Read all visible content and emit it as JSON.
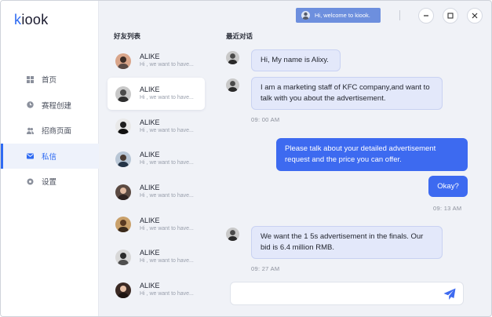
{
  "app": {
    "logo": "kiook",
    "logo_accent": "k",
    "logo_rest": "iook"
  },
  "header": {
    "welcome": "Hi, welcome to kiook."
  },
  "sidebar": {
    "items": [
      {
        "label": "首页",
        "icon": "dashboard-icon",
        "active": false
      },
      {
        "label": "赛程创建",
        "icon": "clock-icon",
        "active": false
      },
      {
        "label": "招商页面",
        "icon": "people-icon",
        "active": false
      },
      {
        "label": "私信",
        "icon": "mail-icon",
        "active": true
      },
      {
        "label": "设置",
        "icon": "gear-icon",
        "active": false
      }
    ]
  },
  "friends": {
    "title": "好友列表",
    "items": [
      {
        "name": "ALIKE",
        "preview": "Hi , we want to have..."
      },
      {
        "name": "ALIKE",
        "preview": "Hi , we want to have..."
      },
      {
        "name": "ALIKE",
        "preview": "Hi , we want to have..."
      },
      {
        "name": "ALIKE",
        "preview": "Hi , we want to have..."
      },
      {
        "name": "ALIKE",
        "preview": "Hi , we want to have..."
      },
      {
        "name": "ALIKE",
        "preview": "Hi , we want to have..."
      },
      {
        "name": "ALIKE",
        "preview": "Hi , we want to have..."
      },
      {
        "name": "ALIKE",
        "preview": "Hi , we want to have..."
      }
    ]
  },
  "chat": {
    "title": "最近对话",
    "messages": [
      {
        "text": "Hi, My name is Alixy."
      },
      {
        "text": "I am a marketing staff of KFC company,and want to talk with you about the advertisement."
      },
      {
        "time": "09: 00 AM"
      },
      {
        "text": "Please talk about your detailed advertisement request and the price you can offer."
      },
      {
        "text": "Okay?"
      },
      {
        "time": "09: 13 AM"
      },
      {
        "text": "We want the 1 5s advertisement in the finals. Our bid is 6.4 million RMB."
      },
      {
        "time": "09: 27 AM"
      }
    ],
    "composer_value": "",
    "composer_placeholder": ""
  },
  "colors": {
    "accent": "#3d6af0",
    "incoming_bubble": "#e3e8fa",
    "welcome_badge": "#6d8fde"
  }
}
